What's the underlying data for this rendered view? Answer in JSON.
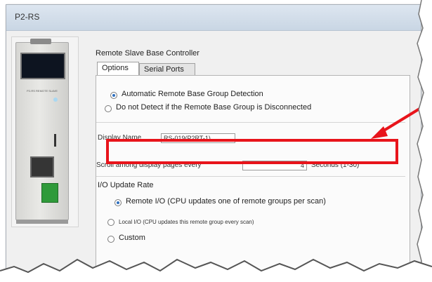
{
  "window": {
    "title": "P2-RS"
  },
  "device": {
    "model_text": "P2-RS REMOTE SLAVE"
  },
  "section_heading": "Remote Slave Base Controller",
  "tabs": [
    {
      "label": "Options",
      "active": true
    },
    {
      "label": "Serial Ports",
      "active": false
    }
  ],
  "detection": {
    "option1": "Automatic Remote Base Group Detection",
    "option2": "Do not Detect if the Remote Base Group is Disconnected",
    "selected": 1
  },
  "display_name": {
    "label": "Display Name",
    "value": "RS-019(P2RT-1)"
  },
  "scroll": {
    "label": "Scroll among display pages every",
    "value": "4",
    "unit": "Seconds (1-30)"
  },
  "io_update": {
    "heading": "I/O Update Rate",
    "options": [
      "Remote I/O (CPU updates one of remote groups per scan)",
      "Local I/O (CPU updates this remote group every scan)",
      "Custom"
    ],
    "selected": 1
  },
  "colors": {
    "highlight": "#e8141b",
    "title_bar": "#c9d6e4",
    "accent": "#2e6fbf"
  },
  "annotation": {
    "icon": "red-arrow-icon"
  }
}
